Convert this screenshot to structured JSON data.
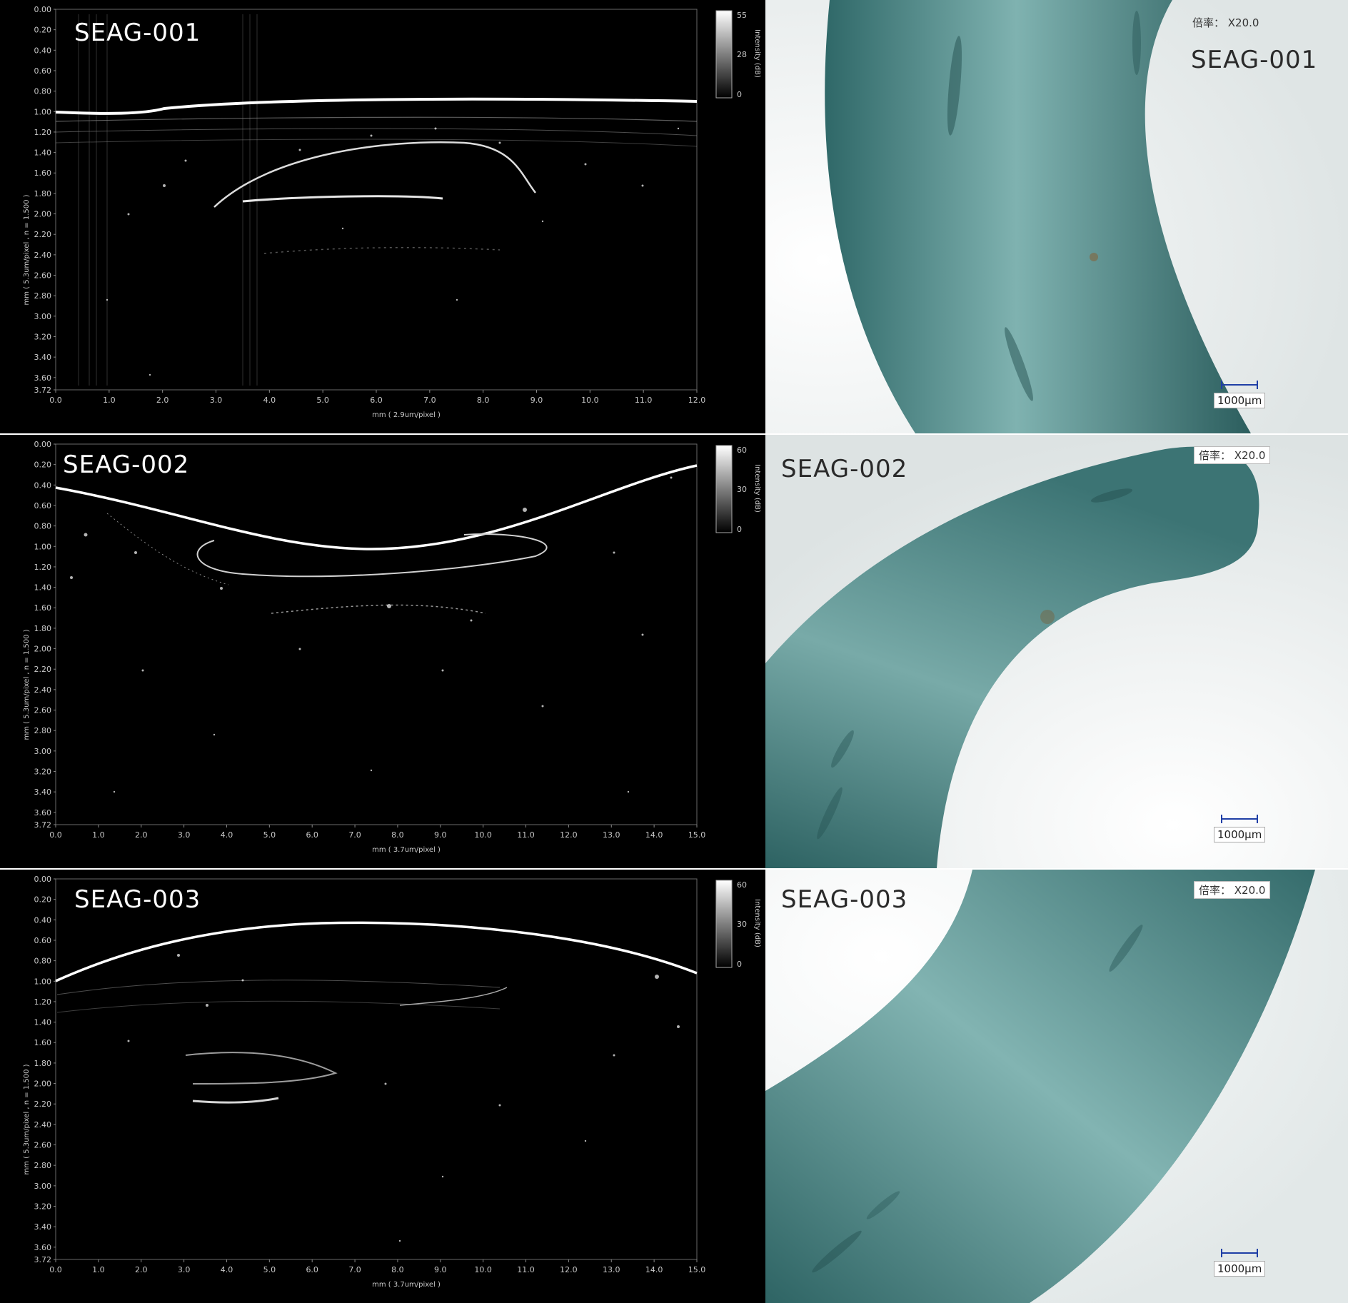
{
  "panels": [
    {
      "id": "SEAG-001",
      "oct": {
        "label": "SEAG-001",
        "y_axis_title": "mm ( 5.3um/pixel , n = 1.500 )",
        "x_axis_title": "mm ( 2.9um/pixel )",
        "y_ticks": [
          "0.00",
          "0.20",
          "0.40",
          "0.60",
          "0.80",
          "1.00",
          "1.20",
          "1.40",
          "1.60",
          "1.80",
          "2.00",
          "2.20",
          "2.40",
          "2.60",
          "2.80",
          "3.00",
          "3.20",
          "3.40",
          "3.60",
          "3.72"
        ],
        "x_ticks": [
          "0.0",
          "1.0",
          "2.0",
          "3.0",
          "4.0",
          "5.0",
          "6.0",
          "7.0",
          "8.0",
          "9.0",
          "10.0",
          "11.0",
          "12.0"
        ],
        "colorbar_title": "Intensity (dB)",
        "colorbar_ticks": [
          "55",
          "28",
          "0"
        ]
      },
      "micro": {
        "label": "SEAG-001",
        "magnification": "倍率： X20.0",
        "scale": "1000μm"
      }
    },
    {
      "id": "SEAG-002",
      "oct": {
        "label": "SEAG-002",
        "y_axis_title": "mm ( 5.3um/pixel , n = 1.500 )",
        "x_axis_title": "mm ( 3.7um/pixel )",
        "y_ticks": [
          "0.00",
          "0.20",
          "0.40",
          "0.60",
          "0.80",
          "1.00",
          "1.20",
          "1.40",
          "1.60",
          "1.80",
          "2.00",
          "2.20",
          "2.40",
          "2.60",
          "2.80",
          "3.00",
          "3.20",
          "3.40",
          "3.60",
          "3.72"
        ],
        "x_ticks": [
          "0.0",
          "1.0",
          "2.0",
          "3.0",
          "4.0",
          "5.0",
          "6.0",
          "7.0",
          "8.0",
          "9.0",
          "10.0",
          "11.0",
          "12.0",
          "13.0",
          "14.0",
          "15.0"
        ],
        "colorbar_title": "Intensity (dB)",
        "colorbar_ticks": [
          "60",
          "30",
          "0"
        ]
      },
      "micro": {
        "label": "SEAG-002",
        "magnification": "倍率： X20.0",
        "scale": "1000μm"
      }
    },
    {
      "id": "SEAG-003",
      "oct": {
        "label": "SEAG-003",
        "y_axis_title": "mm ( 5.3um/pixel , n = 1.500 )",
        "x_axis_title": "mm ( 3.7um/pixel )",
        "y_ticks": [
          "0.00",
          "0.20",
          "0.40",
          "0.60",
          "0.80",
          "1.00",
          "1.20",
          "1.40",
          "1.60",
          "1.80",
          "2.00",
          "2.20",
          "2.40",
          "2.60",
          "2.80",
          "3.00",
          "3.20",
          "3.40",
          "3.60",
          "3.72"
        ],
        "x_ticks": [
          "0.0",
          "1.0",
          "2.0",
          "3.0",
          "4.0",
          "5.0",
          "6.0",
          "7.0",
          "8.0",
          "9.0",
          "10.0",
          "11.0",
          "12.0",
          "13.0",
          "14.0",
          "15.0"
        ],
        "colorbar_title": "Intensity (dB)",
        "colorbar_ticks": [
          "60",
          "30",
          "0"
        ]
      },
      "micro": {
        "label": "SEAG-003",
        "magnification": "倍率： X20.0",
        "scale": "1000μm"
      }
    }
  ],
  "colors": {
    "oct_background": "#000000",
    "oct_signal": "#ffffff",
    "glass_green": "#4f8c8c",
    "microscope_background": "#f4f6f6",
    "scale_bar": "#1f3fa6"
  }
}
